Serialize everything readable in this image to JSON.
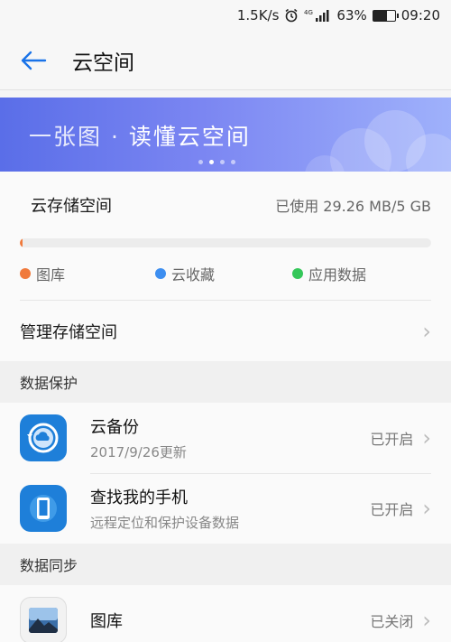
{
  "status_bar": {
    "speed": "1.5K/s",
    "network": "4G",
    "battery": "63%",
    "battery_level": 0.63,
    "time": "09:20"
  },
  "header": {
    "title": "云空间"
  },
  "banner": {
    "text_left": "一张图 · ",
    "text_right": "读懂云空间",
    "dots": 4,
    "active_dot": 1
  },
  "storage": {
    "title": "云存储空间",
    "used": "已使用 29.26 MB/5 GB",
    "used_fraction": 0.0057,
    "legend": [
      {
        "label": "图库",
        "color": "#f07a3c"
      },
      {
        "label": "云收藏",
        "color": "#3d8ef0"
      },
      {
        "label": "应用数据",
        "color": "#34c759"
      }
    ],
    "manage_label": "管理存储空间"
  },
  "sections": {
    "protection": {
      "title": "数据保护",
      "items": [
        {
          "title": "云备份",
          "subtitle": "2017/9/26更新",
          "status": "已开启",
          "icon": "cloud-backup-icon"
        },
        {
          "title": "查找我的手机",
          "subtitle": "远程定位和保护设备数据",
          "status": "已开启",
          "icon": "find-phone-icon"
        }
      ]
    },
    "sync": {
      "title": "数据同步",
      "items": [
        {
          "title": "图库",
          "status": "已关闭",
          "icon": "gallery-icon"
        }
      ]
    }
  },
  "colors": {
    "accent": "#1a73e8",
    "banner_start": "#5a6ee8",
    "banner_end": "#9fb1fb"
  }
}
